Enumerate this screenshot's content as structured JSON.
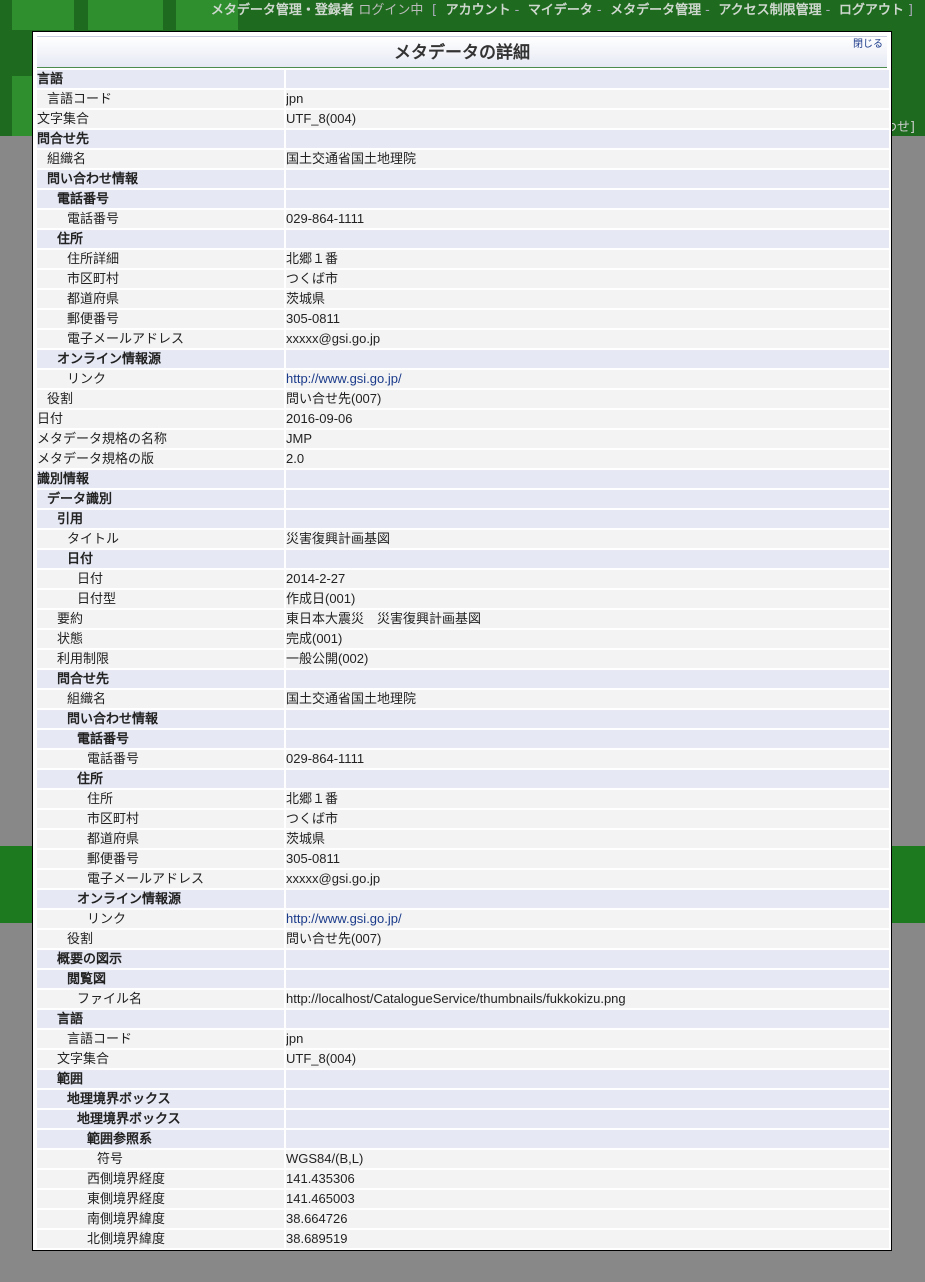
{
  "header": {
    "site_title": "メタデータ管理・登録者",
    "login_status": "ログイン中",
    "nav": [
      "アカウント",
      "マイデータ",
      "メタデータ管理",
      "アクセス制限管理",
      "ログアウト"
    ],
    "right_fragment": "わせ]"
  },
  "modal": {
    "title": "メタデータの詳細",
    "close_label": "閉じる"
  },
  "rows": [
    {
      "key": "言語",
      "value": "",
      "level": 0,
      "group": true
    },
    {
      "key": "言語コード",
      "value": "jpn",
      "level": 1
    },
    {
      "key": "文字集合",
      "value": "UTF_8(004)",
      "level": 0
    },
    {
      "key": "問合せ先",
      "value": "",
      "level": 0,
      "group": true
    },
    {
      "key": "組織名",
      "value": "国土交通省国土地理院",
      "level": 1
    },
    {
      "key": "問い合わせ情報",
      "value": "",
      "level": 1,
      "group": true
    },
    {
      "key": "電話番号",
      "value": "",
      "level": 2,
      "group": true
    },
    {
      "key": "電話番号",
      "value": "029-864-1111",
      "level": 3
    },
    {
      "key": "住所",
      "value": "",
      "level": 2,
      "group": true
    },
    {
      "key": "住所詳細",
      "value": "北郷１番",
      "level": 3
    },
    {
      "key": "市区町村",
      "value": "つくば市",
      "level": 3
    },
    {
      "key": "都道府県",
      "value": "茨城県",
      "level": 3
    },
    {
      "key": "郵便番号",
      "value": "305-0811",
      "level": 3
    },
    {
      "key": "電子メールアドレス",
      "value": "xxxxx@gsi.go.jp",
      "level": 3
    },
    {
      "key": "オンライン情報源",
      "value": "",
      "level": 2,
      "group": true
    },
    {
      "key": "リンク",
      "value": "http://www.gsi.go.jp/",
      "level": 3,
      "link": true
    },
    {
      "key": "役割",
      "value": "問い合せ先(007)",
      "level": 1
    },
    {
      "key": "日付",
      "value": "2016-09-06",
      "level": 0
    },
    {
      "key": "メタデータ規格の名称",
      "value": "JMP",
      "level": 0
    },
    {
      "key": "メタデータ規格の版",
      "value": "2.0",
      "level": 0
    },
    {
      "key": "識別情報",
      "value": "",
      "level": 0,
      "group": true
    },
    {
      "key": "データ識別",
      "value": "",
      "level": 1,
      "group": true
    },
    {
      "key": "引用",
      "value": "",
      "level": 2,
      "group": true
    },
    {
      "key": "タイトル",
      "value": "災害復興計画基図",
      "level": 3
    },
    {
      "key": "日付",
      "value": "",
      "level": 3,
      "group": true
    },
    {
      "key": "日付",
      "value": "2014-2-27",
      "level": 4
    },
    {
      "key": "日付型",
      "value": "作成日(001)",
      "level": 4
    },
    {
      "key": "要約",
      "value": "東日本大震災　災害復興計画基図",
      "level": 2
    },
    {
      "key": "状態",
      "value": "完成(001)",
      "level": 2
    },
    {
      "key": "利用制限",
      "value": "一般公開(002)",
      "level": 2
    },
    {
      "key": "問合せ先",
      "value": "",
      "level": 2,
      "group": true
    },
    {
      "key": "組織名",
      "value": "国土交通省国土地理院",
      "level": 3
    },
    {
      "key": "問い合わせ情報",
      "value": "",
      "level": 3,
      "group": true
    },
    {
      "key": "電話番号",
      "value": "",
      "level": 4,
      "group": true
    },
    {
      "key": "電話番号",
      "value": "029-864-1111",
      "level": 5
    },
    {
      "key": "住所",
      "value": "",
      "level": 4,
      "group": true
    },
    {
      "key": "住所",
      "value": "北郷１番",
      "level": 5
    },
    {
      "key": "市区町村",
      "value": "つくば市",
      "level": 5
    },
    {
      "key": "都道府県",
      "value": "茨城県",
      "level": 5
    },
    {
      "key": "郵便番号",
      "value": "305-0811",
      "level": 5
    },
    {
      "key": "電子メールアドレス",
      "value": "xxxxx@gsi.go.jp",
      "level": 5
    },
    {
      "key": "オンライン情報源",
      "value": "",
      "level": 4,
      "group": true
    },
    {
      "key": "リンク",
      "value": "http://www.gsi.go.jp/",
      "level": 5,
      "link": true
    },
    {
      "key": "役割",
      "value": "問い合せ先(007)",
      "level": 3
    },
    {
      "key": "概要の図示",
      "value": "",
      "level": 2,
      "group": true
    },
    {
      "key": "閲覧図",
      "value": "",
      "level": 3,
      "group": true
    },
    {
      "key": "ファイル名",
      "value": "http://localhost/CatalogueService/thumbnails/fukkokizu.png",
      "level": 4
    },
    {
      "key": "言語",
      "value": "",
      "level": 2,
      "group": true
    },
    {
      "key": "言語コード",
      "value": "jpn",
      "level": 3
    },
    {
      "key": "文字集合",
      "value": "UTF_8(004)",
      "level": 2
    },
    {
      "key": "範囲",
      "value": "",
      "level": 2,
      "group": true
    },
    {
      "key": "地理境界ボックス",
      "value": "",
      "level": 3,
      "group": true
    },
    {
      "key": "地理境界ボックス",
      "value": "",
      "level": 4,
      "group": true
    },
    {
      "key": "範囲参照系",
      "value": "",
      "level": 5,
      "group": true
    },
    {
      "key": "符号",
      "value": "WGS84/(B,L)",
      "level": 6
    },
    {
      "key": "西側境界経度",
      "value": "141.435306",
      "level": 5
    },
    {
      "key": "東側境界経度",
      "value": "141.465003",
      "level": 5
    },
    {
      "key": "南側境界緯度",
      "value": "38.664726",
      "level": 5
    },
    {
      "key": "北側境界緯度",
      "value": "38.689519",
      "level": 5
    }
  ]
}
